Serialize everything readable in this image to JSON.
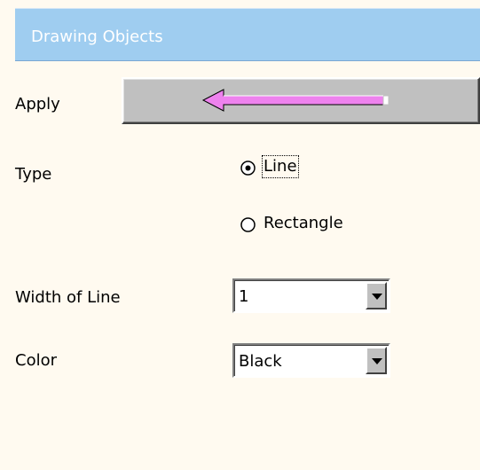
{
  "panel": {
    "title": "Drawing Objects"
  },
  "apply": {
    "label": "Apply",
    "arrow_icon": "left-arrow-icon"
  },
  "type": {
    "label": "Type",
    "options": [
      {
        "label": "Line",
        "selected": true,
        "icon": "radio-selected-icon"
      },
      {
        "label": "Rectangle",
        "selected": false,
        "icon": "radio-unselected-icon"
      }
    ]
  },
  "width_of_line": {
    "label": "Width of Line",
    "value": "1",
    "icon": "chevron-down-icon"
  },
  "color": {
    "label": "Color",
    "value": "Black",
    "icon": "chevron-down-icon"
  },
  "colors": {
    "panel_background": "#fffaf0",
    "title_background": "#9fcdf0",
    "arrow_fill": "#ee82ee"
  }
}
